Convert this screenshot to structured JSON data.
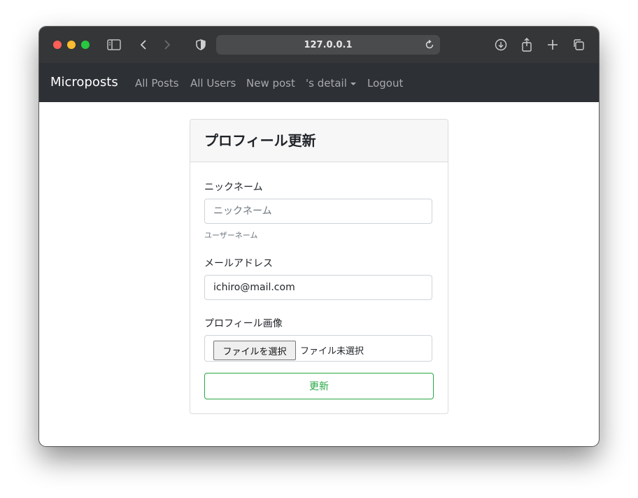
{
  "browser": {
    "url": "127.0.0.1",
    "icons": {
      "sidebar": "sidebar-icon",
      "back": "chevron-left-icon",
      "forward": "chevron-right-icon",
      "shield": "shield-icon",
      "reload": "reload-icon",
      "download": "download-icon",
      "share": "share-icon",
      "new_tab": "plus-icon",
      "tabs": "tabs-icon"
    }
  },
  "navbar": {
    "brand": "Microposts",
    "links": [
      "All Posts",
      "All Users",
      "New post",
      "'s detail",
      "Logout"
    ]
  },
  "form": {
    "title": "プロフィール更新",
    "nickname": {
      "label": "ニックネーム",
      "placeholder": "ニックネーム",
      "value": "",
      "help": "ユーザーネーム"
    },
    "email": {
      "label": "メールアドレス",
      "value": "ichiro@mail.com"
    },
    "image": {
      "label": "プロフィール画像",
      "button": "ファイルを選択",
      "status": "ファイル未選択"
    },
    "submit": "更新"
  },
  "colors": {
    "navbar_bg": "#2d3035",
    "accent_green": "#28a745"
  }
}
